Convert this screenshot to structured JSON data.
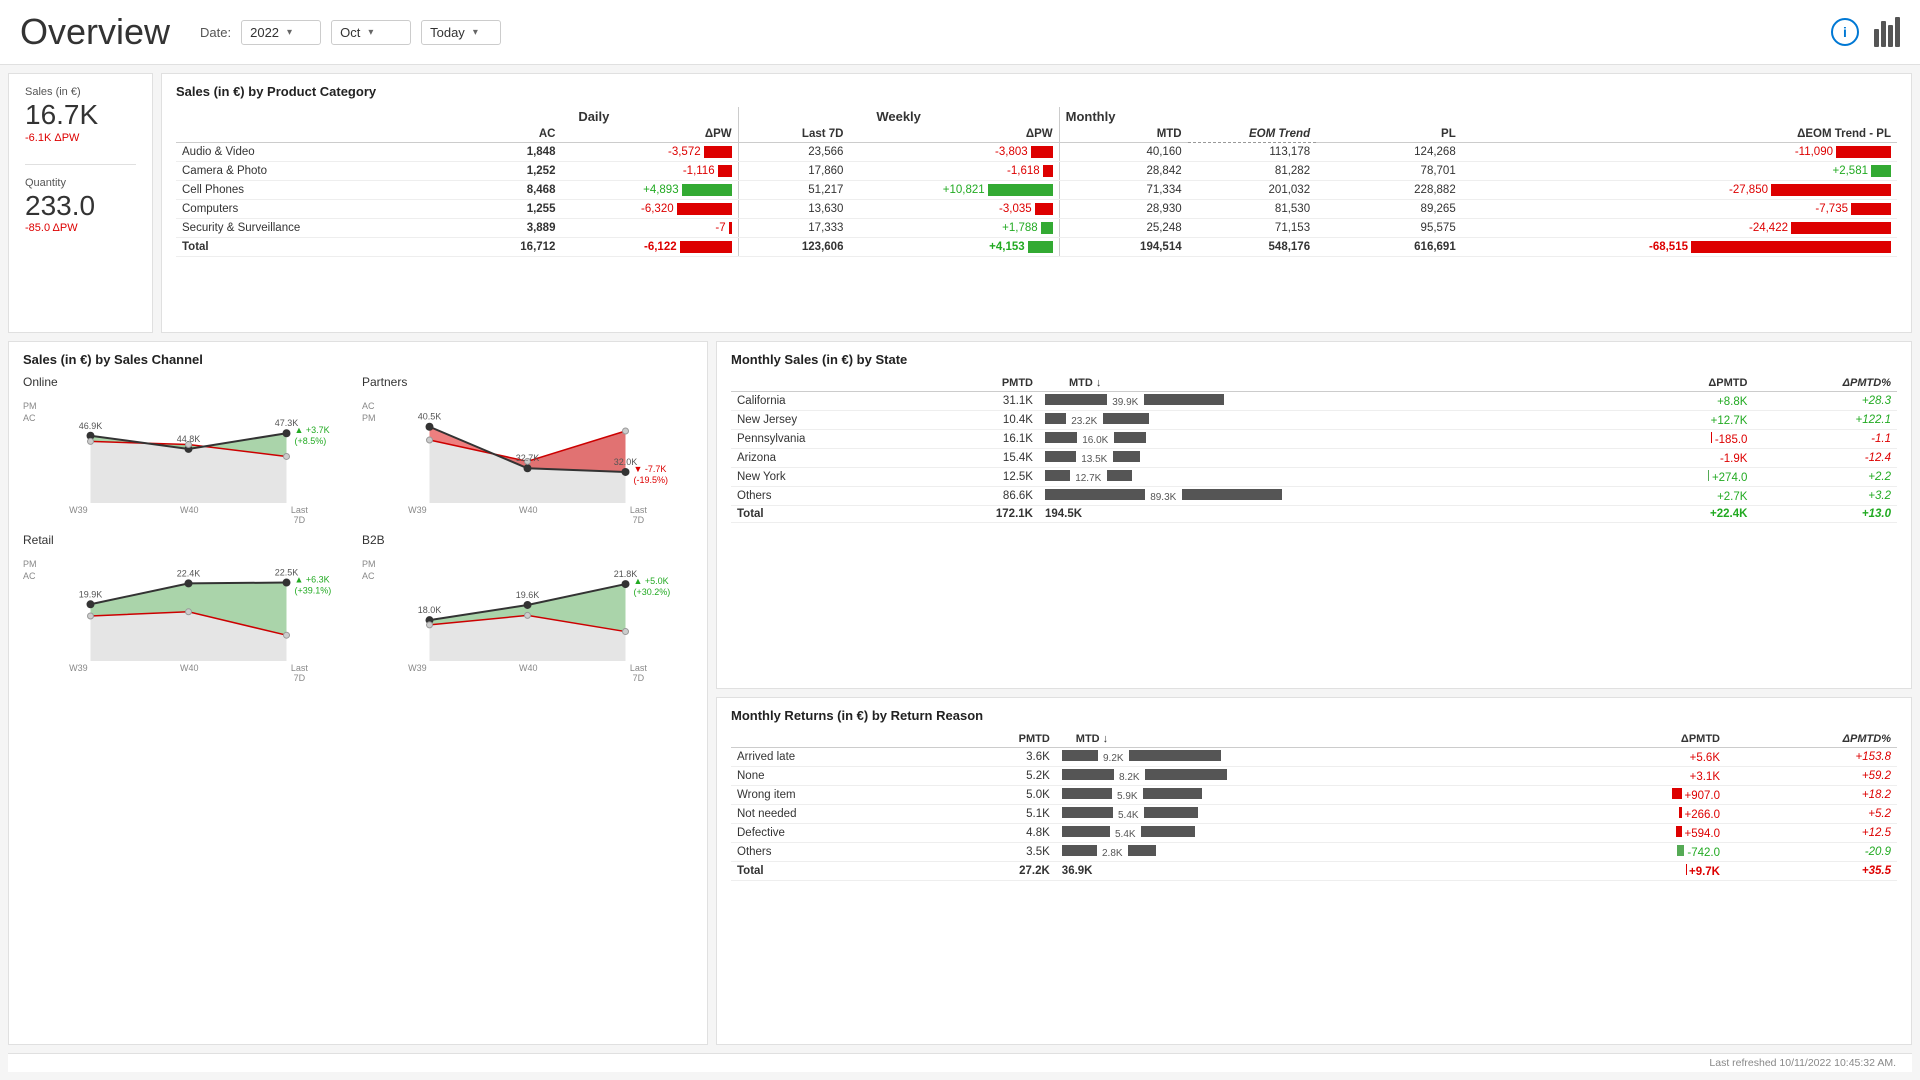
{
  "header": {
    "title": "Overview",
    "date_label": "Date:",
    "year": "2022",
    "month": "Oct",
    "period": "Today",
    "info_icon": "i",
    "last_refreshed": "Last refreshed 10/11/2022 10:45:32 AM."
  },
  "kpi": {
    "sales_label": "Sales (in €)",
    "sales_value": "16.7K",
    "sales_delta": "-6.1K ΔPW",
    "quantity_label": "Quantity",
    "quantity_value": "233.0",
    "quantity_delta": "-85.0 ΔPW"
  },
  "product_table": {
    "title": "Sales (in €) by Product Category",
    "sections": {
      "daily": "Daily",
      "weekly": "Weekly",
      "monthly": "Monthly"
    },
    "headers": {
      "category": "",
      "daily_ac": "AC",
      "daily_dpw": "ΔPW",
      "weekly_last7d": "Last 7D",
      "weekly_dpw": "ΔPW",
      "monthly_mtd": "MTD",
      "monthly_eom": "EOM Trend",
      "monthly_pl": "PL",
      "monthly_deom": "ΔEOM Trend - PL"
    },
    "rows": [
      {
        "name": "Audio & Video",
        "daily_ac": "1,848",
        "daily_dpw": "-3,572",
        "weekly_last7d": "23,566",
        "weekly_dpw": "-3,803",
        "monthly_mtd": "40,160",
        "monthly_eom": "113,178",
        "monthly_pl": "124,268",
        "monthly_deom": "-11,090",
        "daily_bar": "red",
        "daily_bar_w": 28,
        "weekly_bar": "red",
        "weekly_bar_w": 22,
        "monthly_bar": "red",
        "monthly_bar_w": 55
      },
      {
        "name": "Camera & Photo",
        "daily_ac": "1,252",
        "daily_dpw": "-1,116",
        "weekly_last7d": "17,860",
        "weekly_dpw": "-1,618",
        "monthly_mtd": "28,842",
        "monthly_eom": "81,282",
        "monthly_pl": "78,701",
        "monthly_deom": "+2,581",
        "daily_bar": "red",
        "daily_bar_w": 14,
        "weekly_bar": "red",
        "weekly_bar_w": 10,
        "monthly_bar": "green",
        "monthly_bar_w": 20
      },
      {
        "name": "Cell Phones",
        "daily_ac": "8,468",
        "daily_dpw": "+4,893",
        "weekly_last7d": "51,217",
        "weekly_dpw": "+10,821",
        "monthly_mtd": "71,334",
        "monthly_eom": "201,032",
        "monthly_pl": "228,882",
        "monthly_deom": "-27,850",
        "daily_bar": "green",
        "daily_bar_w": 50,
        "weekly_bar": "green",
        "weekly_bar_w": 65,
        "monthly_bar": "red",
        "monthly_bar_w": 120
      },
      {
        "name": "Computers",
        "daily_ac": "1,255",
        "daily_dpw": "-6,320",
        "weekly_last7d": "13,630",
        "weekly_dpw": "-3,035",
        "monthly_mtd": "28,930",
        "monthly_eom": "81,530",
        "monthly_pl": "89,265",
        "monthly_deom": "-7,735",
        "daily_bar": "red",
        "daily_bar_w": 55,
        "weekly_bar": "red",
        "weekly_bar_w": 18,
        "monthly_bar": "red",
        "monthly_bar_w": 40
      },
      {
        "name": "Security & Surveillance",
        "daily_ac": "3,889",
        "daily_dpw": "-7",
        "weekly_last7d": "17,333",
        "weekly_dpw": "+1,788",
        "monthly_mtd": "25,248",
        "monthly_eom": "71,153",
        "monthly_pl": "95,575",
        "monthly_deom": "-24,422",
        "daily_bar": "red",
        "daily_bar_w": 3,
        "weekly_bar": "green",
        "weekly_bar_w": 12,
        "monthly_bar": "red",
        "monthly_bar_w": 100
      },
      {
        "name": "Total",
        "daily_ac": "16,712",
        "daily_dpw": "-6,122",
        "weekly_last7d": "123,606",
        "weekly_dpw": "+4,153",
        "monthly_mtd": "194,514",
        "monthly_eom": "548,176",
        "monthly_pl": "616,691",
        "monthly_deom": "-68,515",
        "daily_bar": "red",
        "daily_bar_w": 52,
        "weekly_bar": "green",
        "weekly_bar_w": 25,
        "monthly_bar": "red",
        "monthly_bar_w": 200,
        "is_total": true
      }
    ]
  },
  "sales_channel": {
    "title": "Sales (in €) by Sales Channel",
    "channels": [
      {
        "name": "Online",
        "points": [
          46.9,
          44.8,
          47.3
        ],
        "pm_points": [
          46.0,
          45.5,
          43.6
        ],
        "labels": [
          "46.9K",
          "44.8K",
          "47.3K"
        ],
        "x_labels": [
          "W39",
          "W40",
          "Last\n7D"
        ],
        "delta": "+3.7K\n(+8.5%)",
        "delta_type": "up",
        "ac_label": "AC",
        "pm_label": "PM"
      },
      {
        "name": "Partners",
        "points": [
          40.5,
          32.7,
          32.0
        ],
        "pm_points": [
          38.0,
          34.0,
          39.7
        ],
        "labels": [
          "40.5K",
          "32.7K",
          "32.0K"
        ],
        "x_labels": [
          "W39",
          "W40",
          "Last\n7D"
        ],
        "delta": "-7.7K\n(-19.5%)",
        "delta_type": "down",
        "ac_label": "AC",
        "pm_label": "PM"
      },
      {
        "name": "Retail",
        "points": [
          19.9,
          22.4,
          22.5
        ],
        "pm_points": [
          18.5,
          19.0,
          16.2
        ],
        "labels": [
          "19.9K",
          "22.4K",
          "22.5K"
        ],
        "x_labels": [
          "W39",
          "W40",
          "Last\n7D"
        ],
        "delta": "+6.3K\n(+39.1%)",
        "delta_type": "up",
        "ac_label": "AC",
        "pm_label": "PM"
      },
      {
        "name": "B2B",
        "points": [
          18.0,
          19.6,
          21.8
        ],
        "pm_points": [
          17.5,
          18.5,
          16.8
        ],
        "labels": [
          "18.0K",
          "19.6K",
          "21.8K"
        ],
        "x_labels": [
          "W39",
          "W40",
          "Last\n7D"
        ],
        "delta": "+5.0K\n(+30.2%)",
        "delta_type": "up",
        "ac_label": "AC",
        "pm_label": "PM"
      }
    ]
  },
  "state_sales": {
    "title": "Monthly Sales (in €) by State",
    "headers": {
      "pmtd": "PMTD",
      "mtd": "MTD ↓",
      "dpmtd": "ΔPMTD",
      "dpmtd_pct": "ΔPMTD%"
    },
    "rows": [
      {
        "name": "California",
        "pmtd": "31.1K",
        "mtd": "39.9K",
        "pmtd_bar": 62,
        "mtd_bar": 80,
        "dpmtd": "+8.8K",
        "dpmtd_pct": "+28.3",
        "delta_type": "green",
        "bar_type": "green"
      },
      {
        "name": "New Jersey",
        "pmtd": "10.4K",
        "mtd": "23.2K",
        "pmtd_bar": 21,
        "mtd_bar": 46,
        "dpmtd": "+12.7K",
        "dpmtd_pct": "+122.1",
        "delta_type": "green",
        "bar_type": "green"
      },
      {
        "name": "Pennsylvania",
        "pmtd": "16.1K",
        "mtd": "16.0K",
        "pmtd_bar": 32,
        "mtd_bar": 32,
        "dpmtd": "-185.0",
        "dpmtd_pct": "-1.1",
        "delta_type": "red",
        "bar_type": "red"
      },
      {
        "name": "Arizona",
        "pmtd": "15.4K",
        "mtd": "13.5K",
        "pmtd_bar": 31,
        "mtd_bar": 27,
        "dpmtd": "-1.9K",
        "dpmtd_pct": "-12.4",
        "delta_type": "red",
        "bar_type": "red"
      },
      {
        "name": "New York",
        "pmtd": "12.5K",
        "mtd": "12.7K",
        "pmtd_bar": 25,
        "mtd_bar": 25,
        "dpmtd": "+274.0",
        "dpmtd_pct": "+2.2",
        "delta_type": "green",
        "bar_type": "green"
      },
      {
        "name": "Others",
        "pmtd": "86.6K",
        "mtd": "89.3K",
        "pmtd_bar": 100,
        "mtd_bar": 100,
        "dpmtd": "+2.7K",
        "dpmtd_pct": "+3.2",
        "delta_type": "green",
        "bar_type": "green"
      },
      {
        "name": "Total",
        "pmtd": "172.1K",
        "mtd": "194.5K",
        "dpmtd": "+22.4K",
        "dpmtd_pct": "+13.0",
        "delta_type": "green",
        "is_total": true
      }
    ]
  },
  "returns": {
    "title": "Monthly Returns (in €) by Return Reason",
    "headers": {
      "pmtd": "PMTD",
      "mtd": "MTD ↓",
      "dpmtd": "ΔPMTD",
      "dpmtd_pct": "ΔPMTD%"
    },
    "rows": [
      {
        "name": "Arrived late",
        "pmtd": "3.6K",
        "mtd": "9.2K",
        "pmtd_bar": 36,
        "mtd_bar": 92,
        "dpmtd": "+5.6K",
        "dpmtd_pct": "+153.8",
        "delta_type": "red"
      },
      {
        "name": "None",
        "pmtd": "5.2K",
        "mtd": "8.2K",
        "pmtd_bar": 52,
        "mtd_bar": 82,
        "dpmtd": "+3.1K",
        "dpmtd_pct": "+59.2",
        "delta_type": "red"
      },
      {
        "name": "Wrong item",
        "pmtd": "5.0K",
        "mtd": "5.9K",
        "pmtd_bar": 50,
        "mtd_bar": 59,
        "dpmtd": "+907.0",
        "dpmtd_pct": "+18.2",
        "delta_type": "red"
      },
      {
        "name": "Not needed",
        "pmtd": "5.1K",
        "mtd": "5.4K",
        "pmtd_bar": 51,
        "mtd_bar": 54,
        "dpmtd": "+266.0",
        "dpmtd_pct": "+5.2",
        "delta_type": "red"
      },
      {
        "name": "Defective",
        "pmtd": "4.8K",
        "mtd": "5.4K",
        "pmtd_bar": 48,
        "mtd_bar": 54,
        "dpmtd": "+594.0",
        "dpmtd_pct": "+12.5",
        "delta_type": "red"
      },
      {
        "name": "Others",
        "pmtd": "3.5K",
        "mtd": "2.8K",
        "pmtd_bar": 35,
        "mtd_bar": 28,
        "dpmtd": "-742.0",
        "dpmtd_pct": "-20.9",
        "delta_type": "green"
      },
      {
        "name": "Total",
        "pmtd": "27.2K",
        "mtd": "36.9K",
        "dpmtd": "+9.7K",
        "dpmtd_pct": "+35.5",
        "delta_type": "red",
        "is_total": true
      }
    ]
  }
}
